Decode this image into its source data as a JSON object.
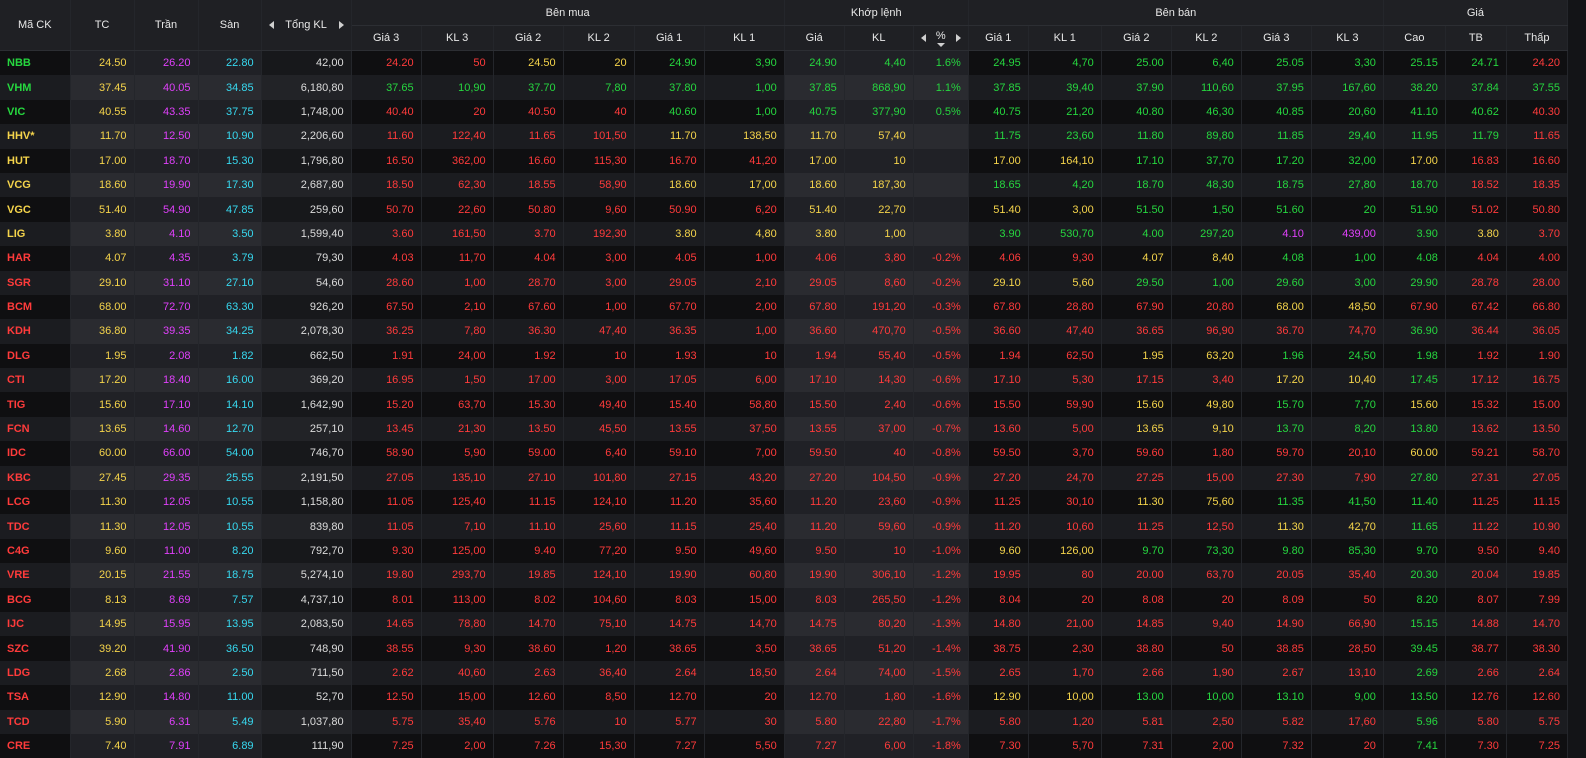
{
  "colors": {
    "up": "#26d63f",
    "down": "#ff3b3b",
    "ref": "#f5d44b",
    "ceil": "#e040fb",
    "floor": "#37d9f0",
    "neutral": "#dcdcdc"
  },
  "headers": {
    "symbol": "Mã CK",
    "tc": "TC",
    "tran": "Trần",
    "san": "Sàn",
    "total_vol": "Tổng KL",
    "buy_group": "Bên mua",
    "match_group": "Khớp lệnh",
    "sell_group": "Bên bán",
    "price_group": "Giá",
    "buy": [
      "Giá 3",
      "KL 3",
      "Giá 2",
      "KL 2",
      "Giá 1",
      "KL 1"
    ],
    "match_price": "Giá",
    "match_vol": "KL",
    "match_pct": "%",
    "sell": [
      "Giá 1",
      "KL 1",
      "Giá 2",
      "KL 2",
      "Giá 3",
      "KL 3"
    ],
    "high": "Cao",
    "avg": "TB",
    "low": "Thấp"
  },
  "rows": [
    {
      "sym": "NBB",
      "tc": "24.50",
      "tran": "26.20",
      "san": "22.80",
      "tot": "42,00",
      "b3": "24.20",
      "bv3": "50",
      "b2": "24.50",
      "bv2": "20",
      "b1": "24.90",
      "bv1": "3,90",
      "mp": "24.90",
      "mv": "4,40",
      "pct": "1.6%",
      "s1": "24.95",
      "sv1": "4,70",
      "s2": "25.00",
      "sv2": "6,40",
      "s3": "25.05",
      "sv3": "3,30",
      "hi": "25.15",
      "avg": "24.71",
      "lo": "24.20"
    },
    {
      "sym": "VHM",
      "tc": "37.45",
      "tran": "40.05",
      "san": "34.85",
      "tot": "6,180,80",
      "b3": "37.65",
      "bv3": "10,90",
      "b2": "37.70",
      "bv2": "7,80",
      "b1": "37.80",
      "bv1": "1,00",
      "mp": "37.85",
      "mv": "868,90",
      "pct": "1.1%",
      "s1": "37.85",
      "sv1": "39,40",
      "s2": "37.90",
      "sv2": "110,60",
      "s3": "37.95",
      "sv3": "167,60",
      "hi": "38.20",
      "avg": "37.84",
      "lo": "37.55"
    },
    {
      "sym": "VIC",
      "tc": "40.55",
      "tran": "43.35",
      "san": "37.75",
      "tot": "1,748,00",
      "b3": "40.40",
      "bv3": "20",
      "b2": "40.50",
      "bv2": "40",
      "b1": "40.60",
      "bv1": "1,00",
      "mp": "40.75",
      "mv": "377,90",
      "pct": "0.5%",
      "s1": "40.75",
      "sv1": "21,20",
      "s2": "40.80",
      "sv2": "46,30",
      "s3": "40.85",
      "sv3": "20,60",
      "hi": "41.10",
      "avg": "40.62",
      "lo": "40.30"
    },
    {
      "sym": "HHV*",
      "tc": "11.70",
      "tran": "12.50",
      "san": "10.90",
      "tot": "2,206,60",
      "b3": "11.60",
      "bv3": "122,40",
      "b2": "11.65",
      "bv2": "101,50",
      "b1": "11.70",
      "bv1": "138,50",
      "mp": "11.70",
      "mv": "57,40",
      "pct": "",
      "s1": "11.75",
      "sv1": "23,60",
      "s2": "11.80",
      "sv2": "89,80",
      "s3": "11.85",
      "sv3": "29,40",
      "hi": "11.95",
      "avg": "11.79",
      "lo": "11.65"
    },
    {
      "sym": "HUT",
      "tc": "17.00",
      "tran": "18.70",
      "san": "15.30",
      "tot": "1,796,80",
      "b3": "16.50",
      "bv3": "362,00",
      "b2": "16.60",
      "bv2": "115,30",
      "b1": "16.70",
      "bv1": "41,20",
      "mp": "17.00",
      "mv": "10",
      "pct": "",
      "s1": "17.00",
      "sv1": "164,10",
      "s2": "17.10",
      "sv2": "37,70",
      "s3": "17.20",
      "sv3": "32,00",
      "hi": "17.00",
      "avg": "16.83",
      "lo": "16.60"
    },
    {
      "sym": "VCG",
      "tc": "18.60",
      "tran": "19.90",
      "san": "17.30",
      "tot": "2,687,80",
      "b3": "18.50",
      "bv3": "62,30",
      "b2": "18.55",
      "bv2": "58,90",
      "b1": "18.60",
      "bv1": "17,00",
      "mp": "18.60",
      "mv": "187,30",
      "pct": "",
      "s1": "18.65",
      "sv1": "4,20",
      "s2": "18.70",
      "sv2": "48,30",
      "s3": "18.75",
      "sv3": "27,80",
      "hi": "18.70",
      "avg": "18.52",
      "lo": "18.35"
    },
    {
      "sym": "VGC",
      "tc": "51.40",
      "tran": "54.90",
      "san": "47.85",
      "tot": "259,60",
      "b3": "50.70",
      "bv3": "22,60",
      "b2": "50.80",
      "bv2": "9,60",
      "b1": "50.90",
      "bv1": "6,20",
      "mp": "51.40",
      "mv": "22,70",
      "pct": "",
      "s1": "51.40",
      "sv1": "3,00",
      "s2": "51.50",
      "sv2": "1,50",
      "s3": "51.60",
      "sv3": "20",
      "hi": "51.90",
      "avg": "51.02",
      "lo": "50.80"
    },
    {
      "sym": "LIG",
      "tc": "3.80",
      "tran": "4.10",
      "san": "3.50",
      "tot": "1,599,40",
      "b3": "3.60",
      "bv3": "161,50",
      "b2": "3.70",
      "bv2": "192,30",
      "b1": "3.80",
      "bv1": "4,80",
      "mp": "3.80",
      "mv": "1,00",
      "pct": "",
      "s1": "3.90",
      "sv1": "530,70",
      "s2": "4.00",
      "sv2": "297,20",
      "s3": "4.10",
      "sv3": "439,00",
      "hi": "3.90",
      "avg": "3.80",
      "lo": "3.70"
    },
    {
      "sym": "HAR",
      "tc": "4.07",
      "tran": "4.35",
      "san": "3.79",
      "tot": "79,30",
      "b3": "4.03",
      "bv3": "11,70",
      "b2": "4.04",
      "bv2": "3,00",
      "b1": "4.05",
      "bv1": "1,00",
      "mp": "4.06",
      "mv": "3,80",
      "pct": "-0.2%",
      "s1": "4.06",
      "sv1": "9,30",
      "s2": "4.07",
      "sv2": "8,40",
      "s3": "4.08",
      "sv3": "1,00",
      "hi": "4.08",
      "avg": "4.04",
      "lo": "4.00"
    },
    {
      "sym": "SGR",
      "tc": "29.10",
      "tran": "31.10",
      "san": "27.10",
      "tot": "54,60",
      "b3": "28.60",
      "bv3": "1,00",
      "b2": "28.70",
      "bv2": "3,00",
      "b1": "29.05",
      "bv1": "2,10",
      "mp": "29.05",
      "mv": "8,60",
      "pct": "-0.2%",
      "s1": "29.10",
      "sv1": "5,60",
      "s2": "29.50",
      "sv2": "1,00",
      "s3": "29.60",
      "sv3": "3,00",
      "hi": "29.90",
      "avg": "28.78",
      "lo": "28.00"
    },
    {
      "sym": "BCM",
      "tc": "68.00",
      "tran": "72.70",
      "san": "63.30",
      "tot": "926,20",
      "b3": "67.50",
      "bv3": "2,10",
      "b2": "67.60",
      "bv2": "1,00",
      "b1": "67.70",
      "bv1": "2,00",
      "mp": "67.80",
      "mv": "191,20",
      "pct": "-0.3%",
      "s1": "67.80",
      "sv1": "28,80",
      "s2": "67.90",
      "sv2": "20,80",
      "s3": "68.00",
      "sv3": "48,50",
      "hi": "67.90",
      "avg": "67.42",
      "lo": "66.80"
    },
    {
      "sym": "KDH",
      "tc": "36.80",
      "tran": "39.35",
      "san": "34.25",
      "tot": "2,078,30",
      "b3": "36.25",
      "bv3": "7,80",
      "b2": "36.30",
      "bv2": "47,40",
      "b1": "36.35",
      "bv1": "1,00",
      "mp": "36.60",
      "mv": "470,70",
      "pct": "-0.5%",
      "s1": "36.60",
      "sv1": "47,40",
      "s2": "36.65",
      "sv2": "96,90",
      "s3": "36.70",
      "sv3": "74,70",
      "hi": "36.90",
      "avg": "36.44",
      "lo": "36.05"
    },
    {
      "sym": "DLG",
      "tc": "1.95",
      "tran": "2.08",
      "san": "1.82",
      "tot": "662,50",
      "b3": "1.91",
      "bv3": "24,00",
      "b2": "1.92",
      "bv2": "10",
      "b1": "1.93",
      "bv1": "10",
      "mp": "1.94",
      "mv": "55,40",
      "pct": "-0.5%",
      "s1": "1.94",
      "sv1": "62,50",
      "s2": "1.95",
      "sv2": "63,20",
      "s3": "1.96",
      "sv3": "24,50",
      "hi": "1.98",
      "avg": "1.92",
      "lo": "1.90"
    },
    {
      "sym": "CTI",
      "tc": "17.20",
      "tran": "18.40",
      "san": "16.00",
      "tot": "369,20",
      "b3": "16.95",
      "bv3": "1,50",
      "b2": "17.00",
      "bv2": "3,00",
      "b1": "17.05",
      "bv1": "6,00",
      "mp": "17.10",
      "mv": "14,30",
      "pct": "-0.6%",
      "s1": "17.10",
      "sv1": "5,30",
      "s2": "17.15",
      "sv2": "3,40",
      "s3": "17.20",
      "sv3": "10,40",
      "hi": "17.45",
      "avg": "17.12",
      "lo": "16.75"
    },
    {
      "sym": "TIG",
      "tc": "15.60",
      "tran": "17.10",
      "san": "14.10",
      "tot": "1,642,90",
      "b3": "15.20",
      "bv3": "63,70",
      "b2": "15.30",
      "bv2": "49,40",
      "b1": "15.40",
      "bv1": "58,80",
      "mp": "15.50",
      "mv": "2,40",
      "pct": "-0.6%",
      "s1": "15.50",
      "sv1": "59,90",
      "s2": "15.60",
      "sv2": "49,80",
      "s3": "15.70",
      "sv3": "7,70",
      "hi": "15.60",
      "avg": "15.32",
      "lo": "15.00"
    },
    {
      "sym": "FCN",
      "tc": "13.65",
      "tran": "14.60",
      "san": "12.70",
      "tot": "257,10",
      "b3": "13.45",
      "bv3": "21,30",
      "b2": "13.50",
      "bv2": "45,50",
      "b1": "13.55",
      "bv1": "37,50",
      "mp": "13.55",
      "mv": "37,00",
      "pct": "-0.7%",
      "s1": "13.60",
      "sv1": "5,00",
      "s2": "13.65",
      "sv2": "9,10",
      "s3": "13.70",
      "sv3": "8,20",
      "hi": "13.80",
      "avg": "13.62",
      "lo": "13.50"
    },
    {
      "sym": "IDC",
      "tc": "60.00",
      "tran": "66.00",
      "san": "54.00",
      "tot": "746,70",
      "b3": "58.90",
      "bv3": "5,90",
      "b2": "59.00",
      "bv2": "6,40",
      "b1": "59.10",
      "bv1": "7,00",
      "mp": "59.50",
      "mv": "40",
      "pct": "-0.8%",
      "s1": "59.50",
      "sv1": "3,70",
      "s2": "59.60",
      "sv2": "1,80",
      "s3": "59.70",
      "sv3": "20,10",
      "hi": "60.00",
      "avg": "59.21",
      "lo": "58.70"
    },
    {
      "sym": "KBC",
      "tc": "27.45",
      "tran": "29.35",
      "san": "25.55",
      "tot": "2,191,50",
      "b3": "27.05",
      "bv3": "135,10",
      "b2": "27.10",
      "bv2": "101,80",
      "b1": "27.15",
      "bv1": "43,20",
      "mp": "27.20",
      "mv": "104,50",
      "pct": "-0.9%",
      "s1": "27.20",
      "sv1": "24,70",
      "s2": "27.25",
      "sv2": "15,00",
      "s3": "27.30",
      "sv3": "7,90",
      "hi": "27.80",
      "avg": "27.31",
      "lo": "27.05"
    },
    {
      "sym": "LCG",
      "tc": "11.30",
      "tran": "12.05",
      "san": "10.55",
      "tot": "1,158,80",
      "b3": "11.05",
      "bv3": "125,40",
      "b2": "11.15",
      "bv2": "124,10",
      "b1": "11.20",
      "bv1": "35,60",
      "mp": "11.20",
      "mv": "23,60",
      "pct": "-0.9%",
      "s1": "11.25",
      "sv1": "30,10",
      "s2": "11.30",
      "sv2": "75,60",
      "s3": "11.35",
      "sv3": "41,50",
      "hi": "11.40",
      "avg": "11.25",
      "lo": "11.15"
    },
    {
      "sym": "TDC",
      "tc": "11.30",
      "tran": "12.05",
      "san": "10.55",
      "tot": "839,80",
      "b3": "11.05",
      "bv3": "7,10",
      "b2": "11.10",
      "bv2": "25,60",
      "b1": "11.15",
      "bv1": "25,40",
      "mp": "11.20",
      "mv": "59,60",
      "pct": "-0.9%",
      "s1": "11.20",
      "sv1": "10,60",
      "s2": "11.25",
      "sv2": "12,50",
      "s3": "11.30",
      "sv3": "42,70",
      "hi": "11.65",
      "avg": "11.22",
      "lo": "10.90"
    },
    {
      "sym": "C4G",
      "tc": "9.60",
      "tran": "11.00",
      "san": "8.20",
      "tot": "792,70",
      "b3": "9.30",
      "bv3": "125,00",
      "b2": "9.40",
      "bv2": "77,20",
      "b1": "9.50",
      "bv1": "49,60",
      "mp": "9.50",
      "mv": "10",
      "pct": "-1.0%",
      "s1": "9.60",
      "sv1": "126,00",
      "s2": "9.70",
      "sv2": "73,30",
      "s3": "9.80",
      "sv3": "85,30",
      "hi": "9.70",
      "avg": "9.50",
      "lo": "9.40"
    },
    {
      "sym": "VRE",
      "tc": "20.15",
      "tran": "21.55",
      "san": "18.75",
      "tot": "5,274,10",
      "b3": "19.80",
      "bv3": "293,70",
      "b2": "19.85",
      "bv2": "124,10",
      "b1": "19.90",
      "bv1": "60,80",
      "mp": "19.90",
      "mv": "306,10",
      "pct": "-1.2%",
      "s1": "19.95",
      "sv1": "80",
      "s2": "20.00",
      "sv2": "63,70",
      "s3": "20.05",
      "sv3": "35,40",
      "hi": "20.30",
      "avg": "20.04",
      "lo": "19.85"
    },
    {
      "sym": "BCG",
      "tc": "8.13",
      "tran": "8.69",
      "san": "7.57",
      "tot": "4,737,10",
      "b3": "8.01",
      "bv3": "113,00",
      "b2": "8.02",
      "bv2": "104,60",
      "b1": "8.03",
      "bv1": "15,00",
      "mp": "8.03",
      "mv": "265,50",
      "pct": "-1.2%",
      "s1": "8.04",
      "sv1": "20",
      "s2": "8.08",
      "sv2": "20",
      "s3": "8.09",
      "sv3": "50",
      "hi": "8.20",
      "avg": "8.07",
      "lo": "7.99"
    },
    {
      "sym": "IJC",
      "tc": "14.95",
      "tran": "15.95",
      "san": "13.95",
      "tot": "2,083,50",
      "b3": "14.65",
      "bv3": "78,80",
      "b2": "14.70",
      "bv2": "75,10",
      "b1": "14.75",
      "bv1": "14,70",
      "mp": "14.75",
      "mv": "80,20",
      "pct": "-1.3%",
      "s1": "14.80",
      "sv1": "21,00",
      "s2": "14.85",
      "sv2": "9,40",
      "s3": "14.90",
      "sv3": "66,90",
      "hi": "15.15",
      "avg": "14.88",
      "lo": "14.70"
    },
    {
      "sym": "SZC",
      "tc": "39.20",
      "tran": "41.90",
      "san": "36.50",
      "tot": "748,90",
      "b3": "38.55",
      "bv3": "9,30",
      "b2": "38.60",
      "bv2": "1,20",
      "b1": "38.65",
      "bv1": "3,50",
      "mp": "38.65",
      "mv": "51,20",
      "pct": "-1.4%",
      "s1": "38.75",
      "sv1": "2,30",
      "s2": "38.80",
      "sv2": "50",
      "s3": "38.85",
      "sv3": "28,50",
      "hi": "39.45",
      "avg": "38.77",
      "lo": "38.30"
    },
    {
      "sym": "LDG",
      "tc": "2.68",
      "tran": "2.86",
      "san": "2.50",
      "tot": "711,50",
      "b3": "2.62",
      "bv3": "40,60",
      "b2": "2.63",
      "bv2": "36,40",
      "b1": "2.64",
      "bv1": "18,50",
      "mp": "2.64",
      "mv": "74,00",
      "pct": "-1.5%",
      "s1": "2.65",
      "sv1": "1,70",
      "s2": "2.66",
      "sv2": "1,90",
      "s3": "2.67",
      "sv3": "13,10",
      "hi": "2.69",
      "avg": "2.66",
      "lo": "2.64"
    },
    {
      "sym": "TSA",
      "tc": "12.90",
      "tran": "14.80",
      "san": "11.00",
      "tot": "52,70",
      "b3": "12.50",
      "bv3": "15,00",
      "b2": "12.60",
      "bv2": "8,50",
      "b1": "12.70",
      "bv1": "20",
      "mp": "12.70",
      "mv": "1,80",
      "pct": "-1.6%",
      "s1": "12.90",
      "sv1": "10,00",
      "s2": "13.00",
      "sv2": "10,00",
      "s3": "13.10",
      "sv3": "9,00",
      "hi": "13.50",
      "avg": "12.76",
      "lo": "12.60"
    },
    {
      "sym": "TCD",
      "tc": "5.90",
      "tran": "6.31",
      "san": "5.49",
      "tot": "1,037,80",
      "b3": "5.75",
      "bv3": "35,40",
      "b2": "5.76",
      "bv2": "10",
      "b1": "5.77",
      "bv1": "30",
      "mp": "5.80",
      "mv": "22,80",
      "pct": "-1.7%",
      "s1": "5.80",
      "sv1": "1,20",
      "s2": "5.81",
      "sv2": "2,50",
      "s3": "5.82",
      "sv3": "17,60",
      "hi": "5.96",
      "avg": "5.80",
      "lo": "5.75"
    },
    {
      "sym": "CRE",
      "tc": "7.40",
      "tran": "7.91",
      "san": "6.89",
      "tot": "111,90",
      "b3": "7.25",
      "bv3": "2,00",
      "b2": "7.26",
      "bv2": "15,30",
      "b1": "7.27",
      "bv1": "5,50",
      "mp": "7.27",
      "mv": "6,00",
      "pct": "-1.8%",
      "s1": "7.30",
      "sv1": "5,70",
      "s2": "7.31",
      "sv2": "2,00",
      "s3": "7.32",
      "sv3": "20",
      "hi": "7.41",
      "avg": "7.30",
      "lo": "7.25"
    }
  ]
}
